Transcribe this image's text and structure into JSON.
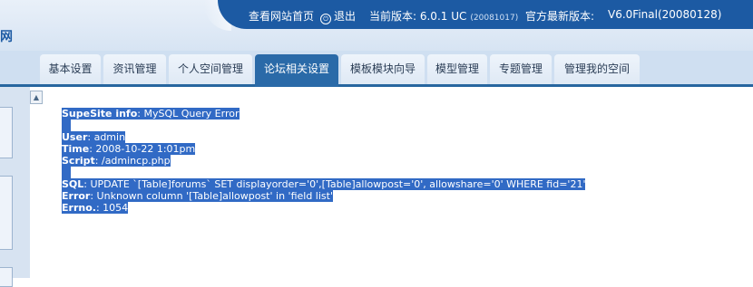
{
  "header": {
    "brand_fragment": "网",
    "view_site_label": "查看网站首页",
    "exit_label": "退出",
    "current_version_label": "当前版本: 6.0.1 UC",
    "current_build": "(20081017)",
    "latest_version_label": "官方最新版本:",
    "latest_version_value": "V6.0Final(20080128)"
  },
  "tabs": [
    {
      "label": "基本设置",
      "active": false
    },
    {
      "label": "资讯管理",
      "active": false
    },
    {
      "label": "个人空间管理",
      "active": false
    },
    {
      "label": "论坛相关设置",
      "active": true
    },
    {
      "label": "模板模块向导",
      "active": false
    },
    {
      "label": "模型管理",
      "active": false
    },
    {
      "label": "专题管理",
      "active": false
    },
    {
      "label": "管理我的空间",
      "active": false
    }
  ],
  "error": {
    "title_key": "SupeSite info",
    "title_value": ": MySQL Query Error",
    "user_key": "User",
    "user_value": ": admin",
    "time_key": "Time",
    "time_value": ": 2008-10-22 1:01pm",
    "script_key": "Script",
    "script_value": ": /admincp.php",
    "sql_key": "SQL",
    "sql_value": ": UPDATE `[Table]forums` SET displayorder='0',[Table]allowpost='0', allowshare='0' WHERE fid='21'",
    "error_key": "Error",
    "error_value": ": Unknown column '[Table]allowpost' in 'field list'",
    "errno_key": "Errno.",
    "errno_value": ": 1054"
  },
  "icons": {
    "exit": "power-icon",
    "scroll_up": "scroll-up-arrow-icon"
  },
  "colors": {
    "header_bar": "#1c5aa3",
    "active_tab": "#2a6aa8",
    "selection": "#316ac5"
  }
}
